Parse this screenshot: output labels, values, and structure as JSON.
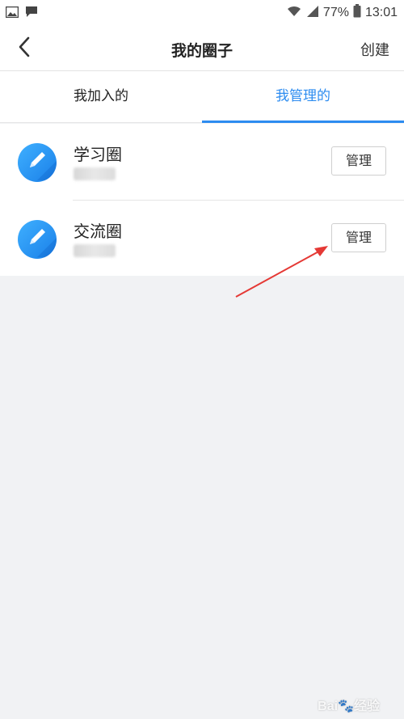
{
  "status_bar": {
    "battery_percent": "77%",
    "time": "13:01",
    "icons": [
      "image-icon",
      "message-icon",
      "wifi-icon",
      "signal-icon",
      "battery-icon"
    ]
  },
  "navbar": {
    "back_icon": "chevron-left-icon",
    "title": "我的圈子",
    "action": "创建"
  },
  "tabs": [
    {
      "label": "我加入的",
      "active": false
    },
    {
      "label": "我管理的",
      "active": true
    }
  ],
  "circles": [
    {
      "name": "学习圈",
      "button": "管理",
      "avatar_icon": "pencil-icon"
    },
    {
      "name": "交流圈",
      "button": "管理",
      "avatar_icon": "pencil-icon"
    }
  ],
  "colors": {
    "accent": "#2d8cf0",
    "background": "#f1f2f4",
    "arrow": "#e53935"
  }
}
